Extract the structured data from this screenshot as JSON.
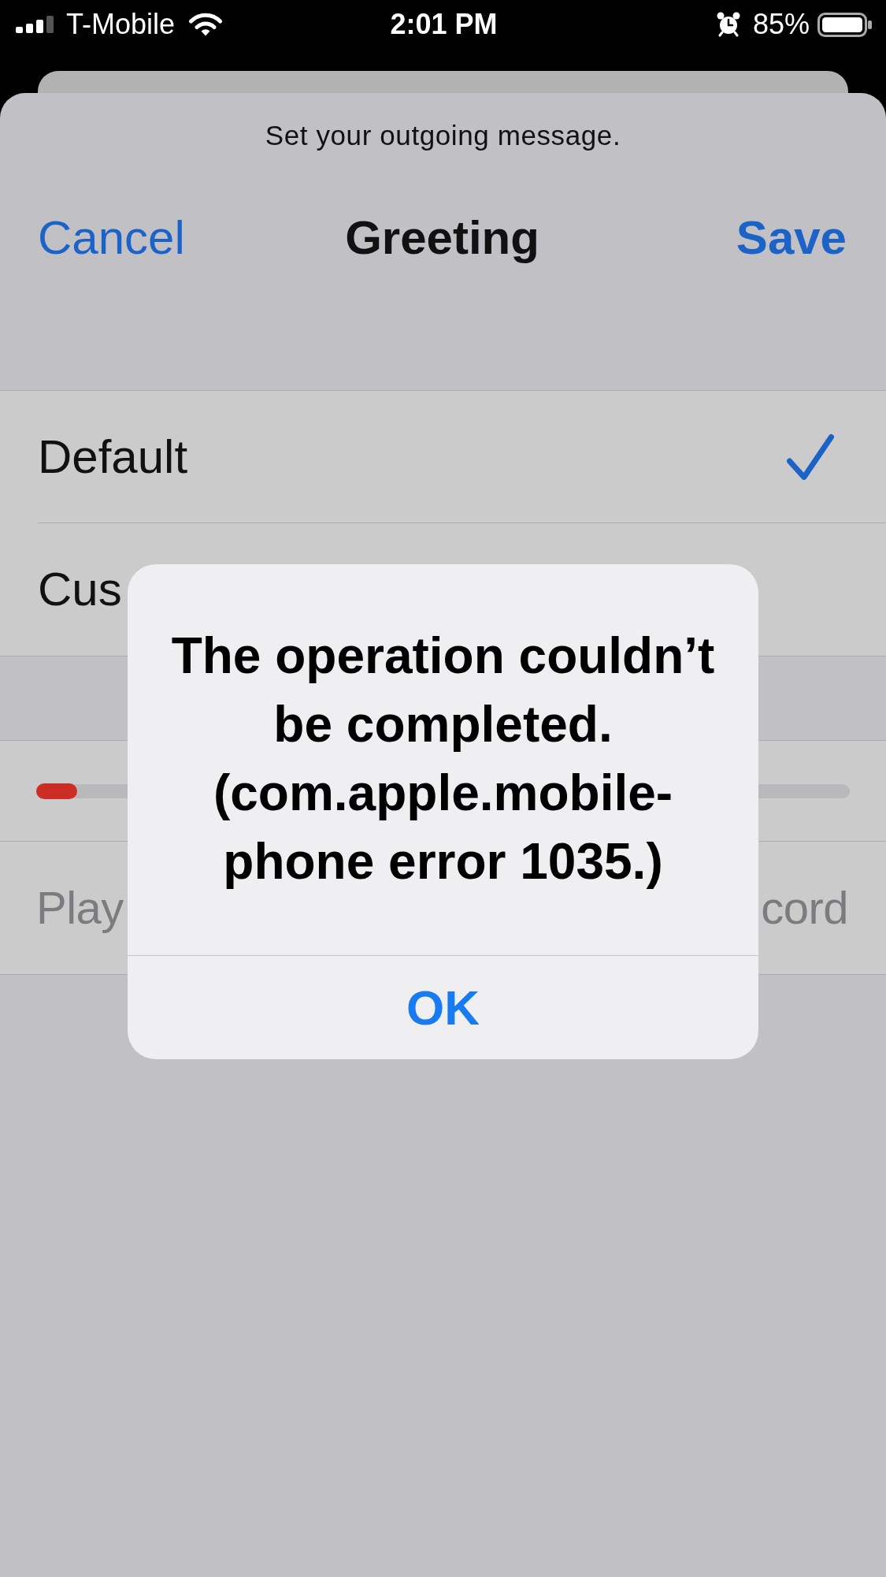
{
  "status_bar": {
    "carrier": "T-Mobile",
    "time": "2:01 PM",
    "battery": "85%"
  },
  "sheet": {
    "subtitle": "Set your outgoing message.",
    "cancel_button": "Cancel",
    "title": "Greeting",
    "save_button": "Save"
  },
  "greeting_options": [
    {
      "label": "Default",
      "selected": true
    },
    {
      "label": "Cus",
      "selected": false
    }
  ],
  "playback": {
    "level": 0.05,
    "buttons": [
      {
        "label": "Play",
        "disabled": true
      },
      {
        "label": "cord",
        "disabled": true
      }
    ]
  },
  "alert": {
    "message": "The operation couldn’t be completed. (com.apple.mobile-phone error 1035.)",
    "buttons": [
      "OK"
    ]
  }
}
